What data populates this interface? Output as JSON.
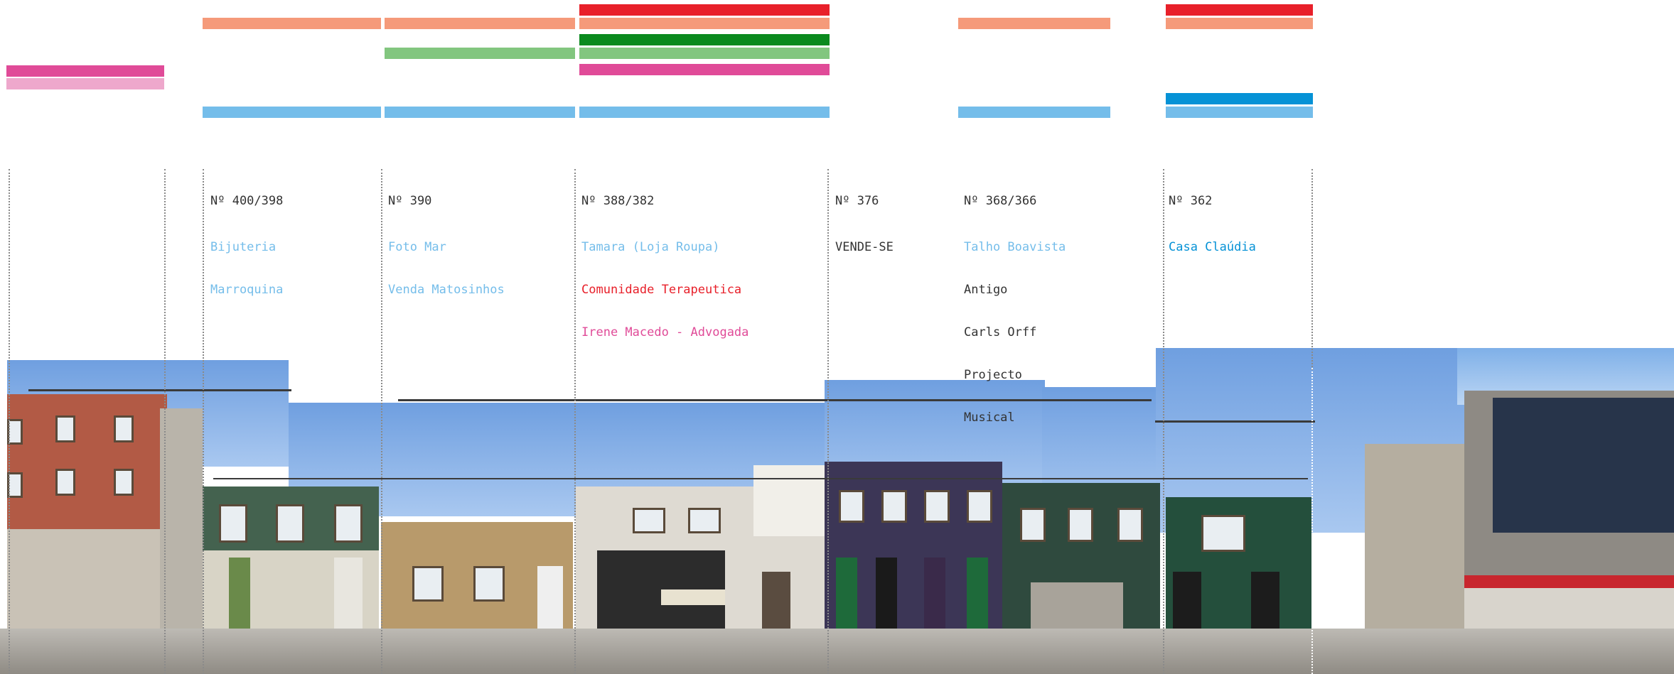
{
  "colors": {
    "red": "#e8202a",
    "salmon": "#f59a7a",
    "dark_green": "#0a8a1e",
    "light_green": "#82c67f",
    "magenta": "#e04b98",
    "light_pink": "#eea8cc",
    "light_blue": "#74bdea",
    "blue": "#0592d6",
    "gray_text": "#333333"
  },
  "sections": [
    {
      "number": "",
      "lines": []
    },
    {
      "number": "Nº 400/398",
      "lines": [
        {
          "text": "Bijuteria",
          "color": "#74bdea"
        },
        {
          "text": "Marroquina",
          "color": "#74bdea"
        }
      ]
    },
    {
      "number": "Nº 390",
      "lines": [
        {
          "text": "Foto Mar",
          "color": "#74bdea"
        },
        {
          "text": "Venda Matosinhos",
          "color": "#74bdea"
        }
      ]
    },
    {
      "number": "Nº 388/382",
      "lines": [
        {
          "text": "Tamara (Loja Roupa)",
          "color": "#74bdea"
        },
        {
          "text": "Comunidade Terapeutica",
          "color": "#e8202a"
        },
        {
          "text": "Irene Macedo - Advogada",
          "color": "#e04b98"
        }
      ]
    },
    {
      "number": "Nº 376",
      "lines": [
        {
          "text": "VENDE-SE",
          "color": "#333333"
        }
      ]
    },
    {
      "number": "Nº 368/366",
      "lines": [
        {
          "text": "Talho Boavista",
          "color": "#74bdea"
        },
        {
          "text": "Antigo",
          "color": "#333333"
        },
        {
          "text": "Carls Orff",
          "color": "#333333"
        },
        {
          "text": "Projecto",
          "color": "#333333"
        },
        {
          "text": "Musical",
          "color": "#333333"
        }
      ]
    },
    {
      "number": "Nº 362",
      "lines": [
        {
          "text": "Casa Claúdia",
          "color": "#0592d6"
        }
      ]
    }
  ]
}
